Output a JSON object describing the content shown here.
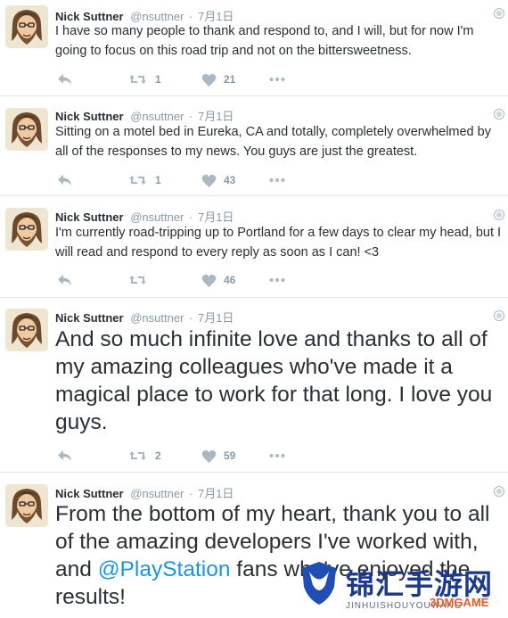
{
  "tweets": [
    {
      "name": "Nick Suttner",
      "handle": "@nsuttner",
      "dot": "·",
      "time": "7月1日",
      "text": "I have so many people to thank and respond to, and I will, but for now I'm going to focus on this road trip and not on the bittersweetness.",
      "retweets": "1",
      "likes": "21"
    },
    {
      "name": "Nick Suttner",
      "handle": "@nsuttner",
      "dot": "·",
      "time": "7月1日",
      "text": "Sitting on a motel bed in Eureka, CA and totally, completely overwhelmed by all of the responses to my news. You guys are just the greatest.",
      "retweets": "1",
      "likes": "43"
    },
    {
      "name": "Nick Suttner",
      "handle": "@nsuttner",
      "dot": "·",
      "time": "7月1日",
      "text": "I'm currently road-tripping up to Portland for a few days to clear my head, but I will read and respond to every reply as soon as I can! <3",
      "retweets": "",
      "likes": "46"
    },
    {
      "name": "Nick Suttner",
      "handle": "@nsuttner",
      "dot": "·",
      "time": "7月1日",
      "text": "And so much infinite love and thanks to all of my amazing colleagues who've made it a magical place to work for that long. I love you guys.",
      "retweets": "2",
      "likes": "59"
    },
    {
      "name": "Nick Suttner",
      "handle": "@nsuttner",
      "dot": "·",
      "time": "7月1日",
      "text_before": "From the bottom of my heart, thank you to all of the amazing developers I've worked with, and ",
      "mention": "@PlayStation",
      "text_after": " fans who've enjoyed the results!"
    }
  ],
  "watermark": {
    "title": "锦汇手游网",
    "sub": "JINHUISHOUYOUWANG",
    "brand": "3DMGAME"
  },
  "colors": {
    "text": "#292f33",
    "muted": "#8899a6",
    "link": "#1b95e0",
    "divider": "#e1e8ed"
  }
}
